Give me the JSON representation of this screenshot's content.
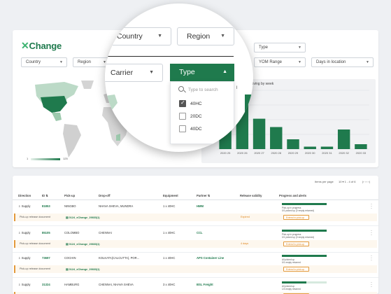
{
  "app": {
    "logo_mark": "✕",
    "logo_text": "Change"
  },
  "filters_row1": [
    {
      "label": "Type"
    }
  ],
  "filters_row2": [
    {
      "label": "Country"
    },
    {
      "label": "Region"
    },
    {
      "label": "YOM Range"
    },
    {
      "label": "Days in location"
    }
  ],
  "map": {
    "legend_min": "1",
    "legend_max": "125"
  },
  "chart_data": {
    "type": "bar",
    "title": "...ainers arriving by week",
    "categories": [
      "2020 25",
      "2020 26",
      "2020 27",
      "2020 28",
      "2020 29",
      "2020 30",
      "2020 31",
      "2020 32",
      "2020 33"
    ],
    "values": [
      42,
      110,
      62,
      45,
      20,
      5,
      5,
      40,
      10
    ],
    "ylim": [
      0,
      120
    ],
    "colors": {
      "bar": "#1f7a4d",
      "grid": "#d9dde1"
    }
  },
  "magnifier": {
    "country_label": "Country",
    "region_label": "Region",
    "carrier_label": "Carrier",
    "type_label": "Type",
    "search_placeholder": "Type to search",
    "options": [
      {
        "label": "40HC",
        "checked": true
      },
      {
        "label": "20DC",
        "checked": false
      },
      {
        "label": "40DC",
        "checked": false
      }
    ],
    "country_partial": "Country"
  },
  "table": {
    "pager": {
      "items_per_page_label": "Items per page",
      "range": "10 ▾  1 - 4 of 6",
      "nav": "|‹  ‹  ›  ›|"
    },
    "columns": [
      "Direction",
      "ID",
      "Pick-up",
      "Drop-off",
      "Equipment",
      "Partner",
      "Release validity",
      "Progress and alerts"
    ],
    "rows": [
      {
        "direction": "Supply",
        "id": "81853",
        "pickup": "NINGBO",
        "dropoff": "NHAVA SHEVA, MUNDRA",
        "equipment": "1 x 40HC",
        "partner": "HMM",
        "progress": 1.0,
        "progress_text1": "Pick-up in progress",
        "progress_text2": "0/1 picked up (0 empty returned)",
        "sub": {
          "label": "Pick-up release document",
          "doc": "0124_xChange_29833(1)",
          "status": "Expired",
          "button": "Extend to pick-up"
        }
      },
      {
        "direction": "Supply",
        "id": "85105",
        "pickup": "COLOMBO",
        "dropoff": "CHENNAI",
        "equipment": "1 x 40HC",
        "partner": "CCL",
        "progress": 1.0,
        "progress_text1": "Pick-up in progress",
        "progress_text2": "0/1 picked up (0 empty returned)",
        "sub": {
          "label": "Pick-up release document",
          "doc": "0124_xChange_29833(1)",
          "status": "4 days",
          "button": "Extend to pick-up"
        }
      },
      {
        "direction": "Supply",
        "id": "73697",
        "pickup": "COCHIN",
        "dropoff": "KOLKATA(CALCUTTA), POR...",
        "equipment": "1 x 40HC",
        "partner": "APS Container Line",
        "progress": 1.0,
        "progress_text1": "All picked up",
        "progress_text2": "0/1 empty returned",
        "sub": {
          "label": "Pick-up release document",
          "doc": "0124_xChange_29833(1)",
          "status": "",
          "button": "Extend to pick-up"
        }
      },
      {
        "direction": "Supply",
        "id": "31324",
        "pickup": "HAMBURG",
        "dropoff": "CHENNAI, NHAVA SHEVA",
        "equipment": "3 x 40HC",
        "partner": "BSL Freight",
        "progress": 0.55,
        "progress_text1": "All picked up",
        "progress_text2": "1/3 empty returned",
        "sub": {
          "label": "Pick-up release document",
          "doc": "0124_xChange_29833(1)",
          "status": "",
          "button": "Extend to pick-up"
        }
      }
    ]
  }
}
